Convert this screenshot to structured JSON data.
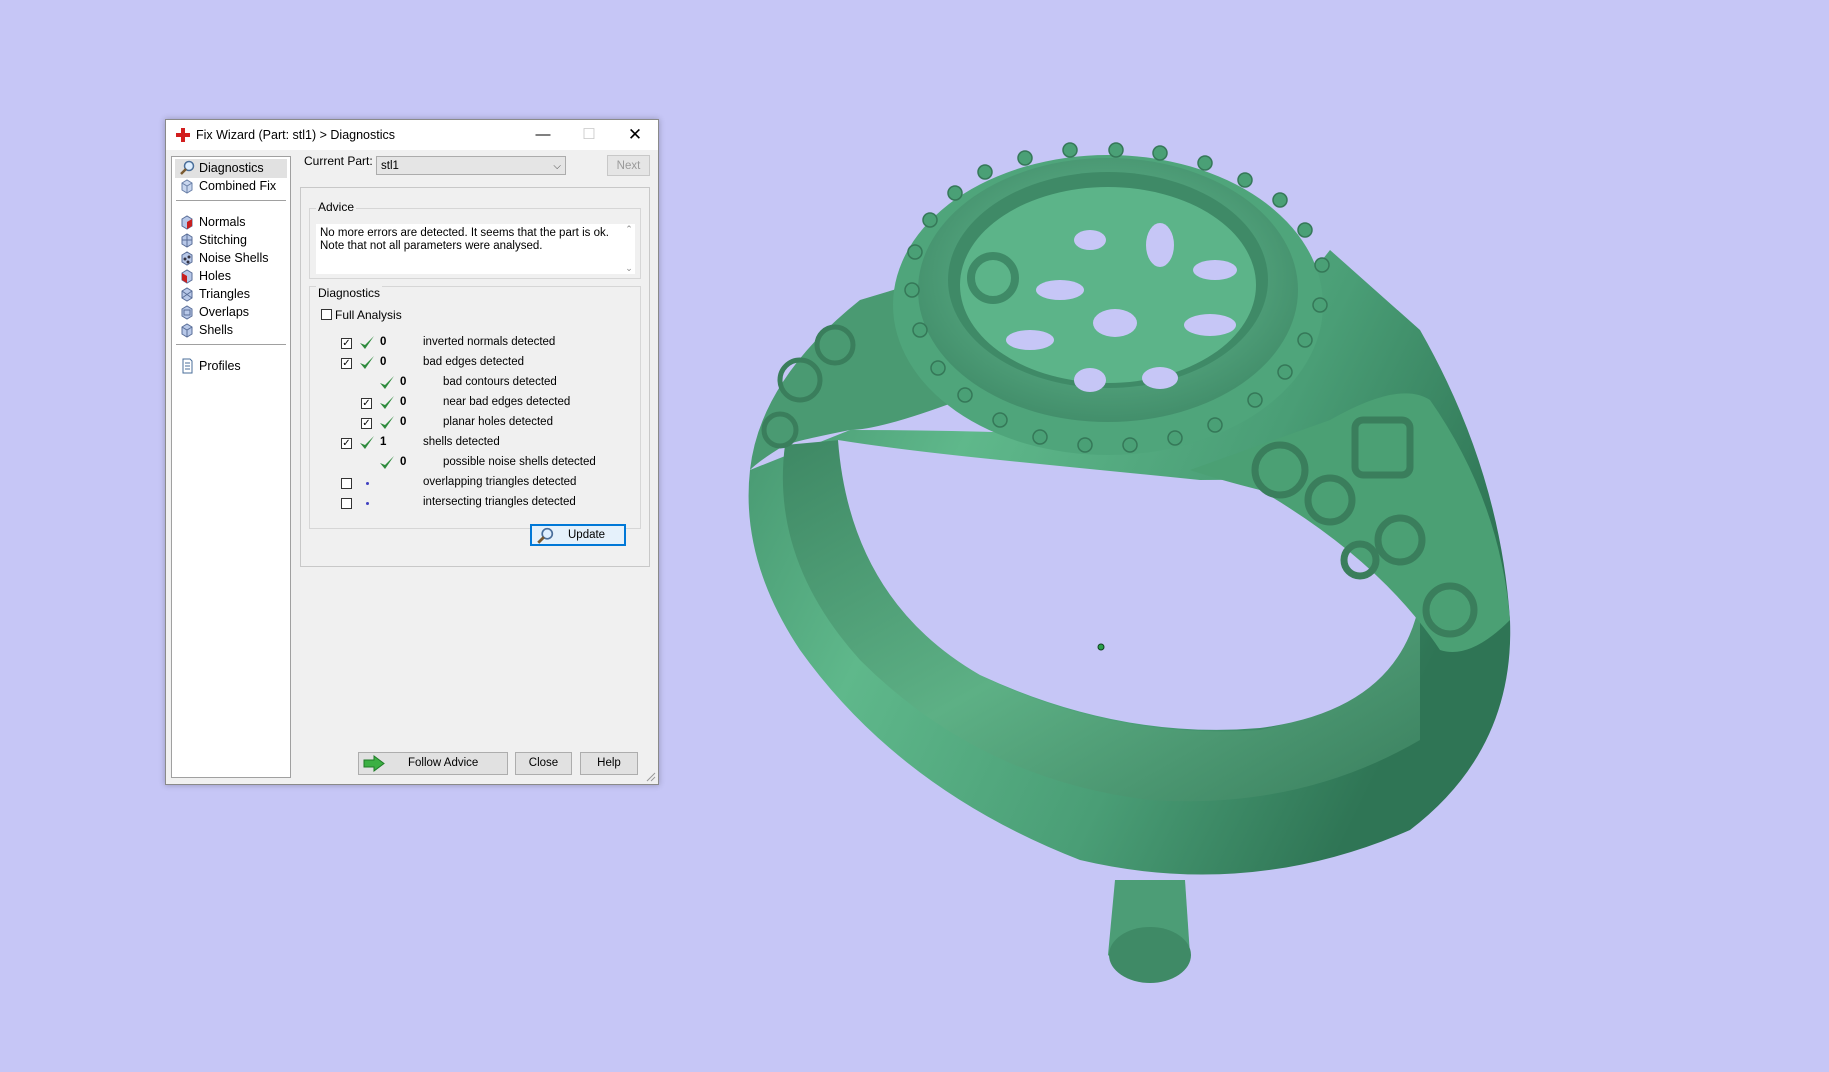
{
  "window": {
    "title": "Fix Wizard (Part: stl1) > Diagnostics",
    "minimize_glyph": "—",
    "maximize_glyph": "☐",
    "close_glyph": "✕"
  },
  "sidebar": {
    "items": [
      {
        "label": "Diagnostics",
        "icon": "magnifier-icon"
      },
      {
        "label": "Combined Fix",
        "icon": "cube-icon"
      },
      {
        "label": "Normals",
        "icon": "normals-cube-icon"
      },
      {
        "label": "Stitching",
        "icon": "stitching-cube-icon"
      },
      {
        "label": "Noise Shells",
        "icon": "noise-shells-cube-icon"
      },
      {
        "label": "Holes",
        "icon": "holes-cube-icon"
      },
      {
        "label": "Triangles",
        "icon": "triangles-cube-icon"
      },
      {
        "label": "Overlaps",
        "icon": "overlaps-cube-icon"
      },
      {
        "label": "Shells",
        "icon": "shells-cube-icon"
      },
      {
        "label": "Profiles",
        "icon": "document-icon"
      }
    ],
    "selected": "Diagnostics"
  },
  "current_part": {
    "label": "Current Part:",
    "value": "stl1",
    "next_label": "Next"
  },
  "advice": {
    "title": "Advice",
    "line1": "No more errors are detected. It seems that the part is ok.",
    "line2": "Note that not all parameters were analysed."
  },
  "diagnostics": {
    "title": "Diagnostics",
    "full_analysis_label": "Full Analysis",
    "full_analysis_checked": false,
    "rows": [
      {
        "checkbox": true,
        "checked": true,
        "status": "ok",
        "count": "0",
        "label": "inverted normals detected"
      },
      {
        "checkbox": true,
        "checked": true,
        "status": "ok",
        "count": "0",
        "label": "bad edges detected"
      },
      {
        "checkbox": false,
        "checked": false,
        "status": "ok",
        "count": "0",
        "label": "bad contours detected"
      },
      {
        "checkbox": true,
        "checked": true,
        "status": "ok",
        "count": "0",
        "label": "near bad edges detected"
      },
      {
        "checkbox": true,
        "checked": true,
        "status": "ok",
        "count": "0",
        "label": "planar holes detected"
      },
      {
        "checkbox": true,
        "checked": true,
        "status": "ok",
        "count": "1",
        "label": "shells detected"
      },
      {
        "checkbox": false,
        "checked": false,
        "status": "ok",
        "count": "0",
        "label": "possible noise shells detected"
      },
      {
        "checkbox": true,
        "checked": false,
        "status": "not-analysed",
        "count": "",
        "label": "overlapping triangles detected"
      },
      {
        "checkbox": true,
        "checked": false,
        "status": "not-analysed",
        "count": "",
        "label": "intersecting triangles detected"
      }
    ],
    "update_label": "Update"
  },
  "footer": {
    "follow_advice_label": "Follow Advice",
    "close_label": "Close",
    "help_label": "Help"
  },
  "colors": {
    "background": "#c6c6f6",
    "model": "#4fa77d",
    "tick": "#2e8b3d",
    "accent": "#0078d7"
  }
}
